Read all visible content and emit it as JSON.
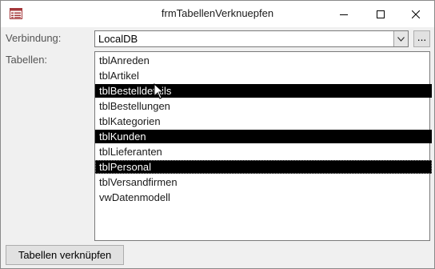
{
  "window": {
    "title": "frmTabellenVerknuepfen"
  },
  "form": {
    "connection_label": "Verbindung:",
    "connection_value": "LocalDB",
    "browse_label": "...",
    "tables_label": "Tabellen:",
    "tables": [
      {
        "name": "tblAnreden",
        "selected": false
      },
      {
        "name": "tblArtikel",
        "selected": false
      },
      {
        "name": "tblBestelldetails",
        "selected": true
      },
      {
        "name": "tblBestellungen",
        "selected": false
      },
      {
        "name": "tblKategorien",
        "selected": false
      },
      {
        "name": "tblKunden",
        "selected": true
      },
      {
        "name": "tblLieferanten",
        "selected": false
      },
      {
        "name": "tblPersonal",
        "selected": true
      },
      {
        "name": "tblVersandfirmen",
        "selected": false
      },
      {
        "name": "vwDatenmodell",
        "selected": false
      }
    ],
    "link_button_label": "Tabellen verknüpfen"
  },
  "icons": {
    "app": "access-form-icon",
    "minimize": "minimize-icon",
    "maximize": "maximize-icon",
    "close": "close-icon",
    "dropdown": "chevron-down-icon",
    "cursor": "mouse-pointer-icon"
  }
}
